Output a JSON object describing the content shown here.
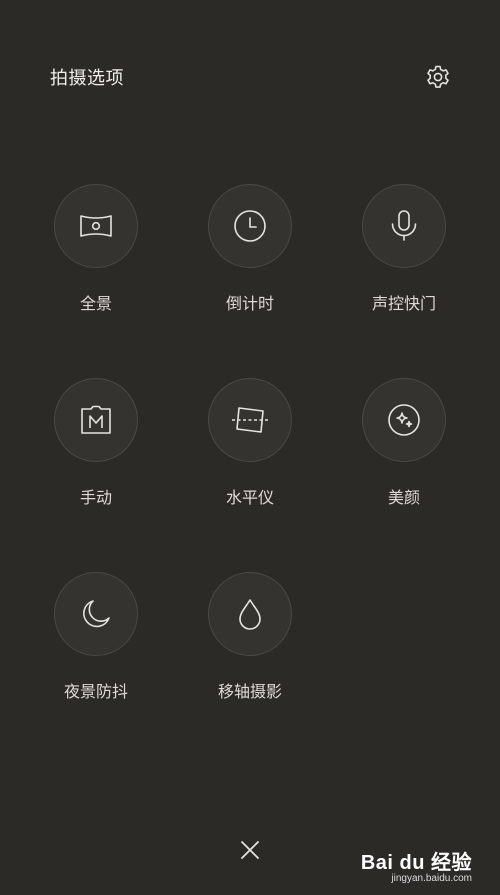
{
  "header": {
    "title": "拍摄选项"
  },
  "options": [
    {
      "label": "全景",
      "icon": "panorama-icon"
    },
    {
      "label": "倒计时",
      "icon": "timer-icon"
    },
    {
      "label": "声控快门",
      "icon": "microphone-icon"
    },
    {
      "label": "手动",
      "icon": "manual-icon"
    },
    {
      "label": "水平仪",
      "icon": "level-icon"
    },
    {
      "label": "美颜",
      "icon": "beauty-icon"
    },
    {
      "label": "夜景防抖",
      "icon": "moon-icon"
    },
    {
      "label": "移轴摄影",
      "icon": "tilt-shift-drop-icon"
    }
  ],
  "footer": {
    "close_icon": "close-icon"
  },
  "watermark": {
    "brand": "Bai du 经验",
    "url": "jingyan.baidu.com"
  },
  "colors": {
    "background": "#2c2a27",
    "circle_fill": "#35332f",
    "circle_border": "#4a4843",
    "text": "#dedbd6"
  }
}
